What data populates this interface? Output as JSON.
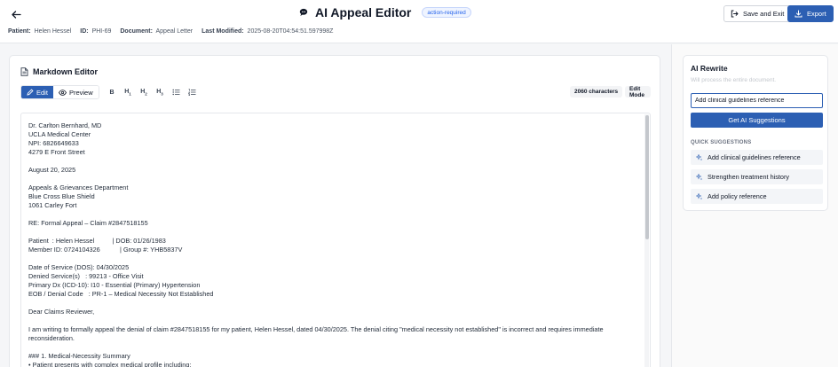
{
  "header": {
    "title": "AI Appeal Editor",
    "status_badge": "action-required",
    "save_exit_label": "Save and Exit",
    "export_label": "Export"
  },
  "meta": {
    "patient_label": "Patient:",
    "patient_value": "Helen Hessel",
    "id_label": "ID:",
    "id_value": "PHI-69",
    "document_label": "Document:",
    "document_value": "Appeal Letter",
    "modified_label": "Last Modified:",
    "modified_value": "2025-08-20T04:54:51.597998Z"
  },
  "editor": {
    "title": "Markdown Editor",
    "edit_label": "Edit",
    "preview_label": "Preview",
    "format_buttons": [
      "B",
      "H1",
      "H2",
      "H3",
      "bullet-list",
      "numbered-list"
    ],
    "char_count": "2060 characters",
    "mode_badge": "Edit Mode",
    "lines": [
      "Dr. Carlton Bernhard, MD",
      "UCLA Medical Center",
      "NPI: 6826649633",
      "4279 E Front Street",
      "",
      "August 20, 2025",
      "",
      "Appeals & Grievances Department",
      "Blue Cross Blue Shield",
      "1061 Carley Fort",
      "",
      "RE: Formal Appeal – Claim #2847518155",
      "",
      "Patient  : Helen Hessel          | DOB: 01/26/1983",
      "Member ID: 0724104326           | Group #: YHB5837V",
      "",
      "Date of Service (DOS): 04/30/2025",
      "Denied Service(s)   : 99213 - Office Visit",
      "Primary Dx (ICD-10): I10 - Essential (Primary) Hypertension",
      "EOB / Denial Code   : PR-1 – Medical Necessity Not Established",
      "",
      "Dear Claims Reviewer,",
      "",
      "I am writing to formally appeal the denial of claim #2847518155 for my patient, Helen Hessel, dated 04/30/2025. The denial citing \"medical necessity not established\" is incorrect and requires immediate",
      "reconsideration.",
      "",
      "### 1. Medical-Necessity Summary",
      "• Patient presents with complex medical profile including:"
    ]
  },
  "ai_panel": {
    "title": "AI Rewrite",
    "subtitle": "Will process the entire document.",
    "input_value": "Add clinical guidelines reference",
    "suggest_button": "Get AI Suggestions",
    "quick_label": "QUICK SUGGESTIONS",
    "suggestions": [
      "Add clinical guidelines reference",
      "Strengthen treatment history",
      "Add policy reference"
    ]
  },
  "colors": {
    "accent": "#2c5fb3",
    "badge_text": "#2563eb"
  }
}
